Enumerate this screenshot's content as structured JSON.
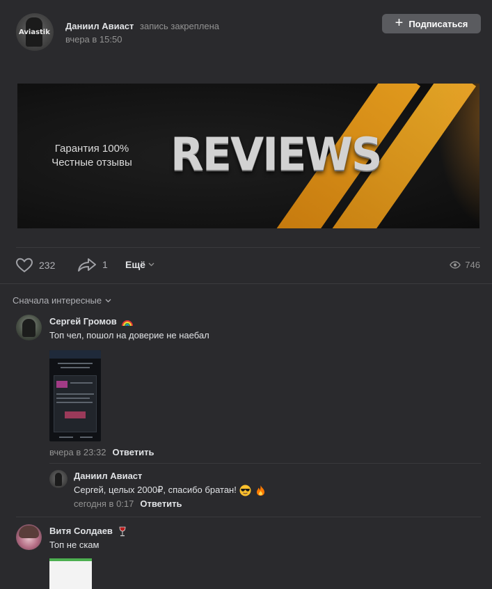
{
  "post": {
    "author": "Даниил Авиаст",
    "pinned_text": "запись закреплена",
    "time": "вчера в 15:50",
    "avatar_tag": "Aviastik",
    "subscribe_label": "Подписаться",
    "banner": {
      "tagline_1": "Гарантия 100%",
      "tagline_2": "Честные отзывы",
      "title": "REVIEWS"
    },
    "likes": "232",
    "shares": "1",
    "more_label": "Ещё",
    "views": "746"
  },
  "comments": {
    "sort_label": "Сначала интересные",
    "items": [
      {
        "author": "Сергей Громов",
        "author_emoji": "rainbow",
        "text": "Топ чел, пошол на доверие не наебал",
        "time": "вчера в 23:32",
        "reply_label": "Ответить",
        "attachment": "screenshot",
        "replies": [
          {
            "author": "Даниил Авиаст",
            "text": "Сергей, целых 2000₽, спасибо братан!",
            "emojis": [
              "sunglasses-face",
              "fire"
            ],
            "time": "сегодня в 0:17",
            "reply_label": "Ответить"
          }
        ]
      },
      {
        "author": "Витя Солдаев",
        "author_emoji": "wine-glass",
        "text": "Топ не скам",
        "attachment": "screenshot"
      }
    ]
  },
  "colors": {
    "background": "#2a2a2d",
    "button": "#5a5b5f",
    "text_primary": "#e1e3e6",
    "text_secondary": "#939393",
    "banner_accent": "#f2a51e"
  }
}
